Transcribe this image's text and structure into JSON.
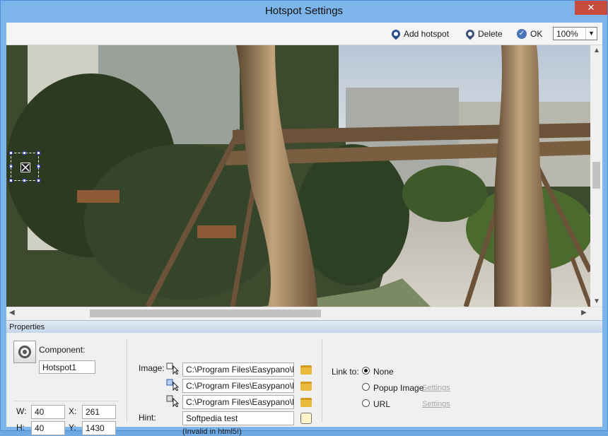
{
  "window": {
    "title": "Hotspot Settings",
    "close_label": "✕"
  },
  "toolbar": {
    "add_hotspot": "Add hotspot",
    "delete": "Delete",
    "ok": "OK",
    "zoom": "100%"
  },
  "properties": {
    "header": "Properties",
    "component_label": "Component:",
    "component_name": "Hotspot1",
    "w_label": "W:",
    "w_value": "40",
    "h_label": "H:",
    "h_value": "40",
    "x_label": "X:",
    "x_value": "261",
    "y_label": "Y:",
    "y_value": "1430",
    "image_label": "Image:",
    "image_paths": [
      "C:\\Program Files\\Easypano\\Pan",
      "C:\\Program Files\\Easypano\\Pan",
      "C:\\Program Files\\Easypano\\Pan"
    ],
    "hint_label": "Hint:",
    "hint_value": "Softpedia test",
    "hint_note": "(Invalid in html5!)",
    "link_label": "Link to:",
    "link_none": "None",
    "link_popup": "Popup Image",
    "link_url": "URL",
    "settings_label": "Settings"
  },
  "colors": {
    "window_frame": "#7db4ea",
    "close_button": "#c74a3c",
    "disabled_link": "#a7a7a7"
  }
}
